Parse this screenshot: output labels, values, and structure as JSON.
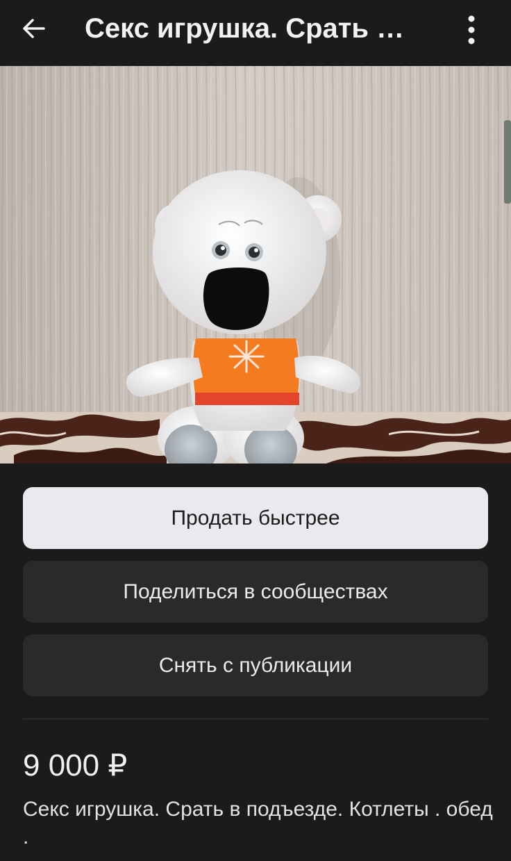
{
  "header": {
    "title": "Секс игрушка. Срать в подъезде. Котлеты . обед ."
  },
  "actions": {
    "sell_faster": "Продать быстрее",
    "share_communities": "Поделиться в сообществах",
    "unpublish": "Снять с публикации"
  },
  "listing": {
    "price": "9 000 ₽",
    "description": "Секс игрушка. Срать в подъезде. Котлеты . обед ."
  },
  "icons": {
    "back": "arrow-left-icon",
    "menu": "more-vertical-icon"
  },
  "colors": {
    "background": "#1b1b1b",
    "primary_button": "#e9e9ee",
    "secondary_button": "#2a2a2a"
  }
}
